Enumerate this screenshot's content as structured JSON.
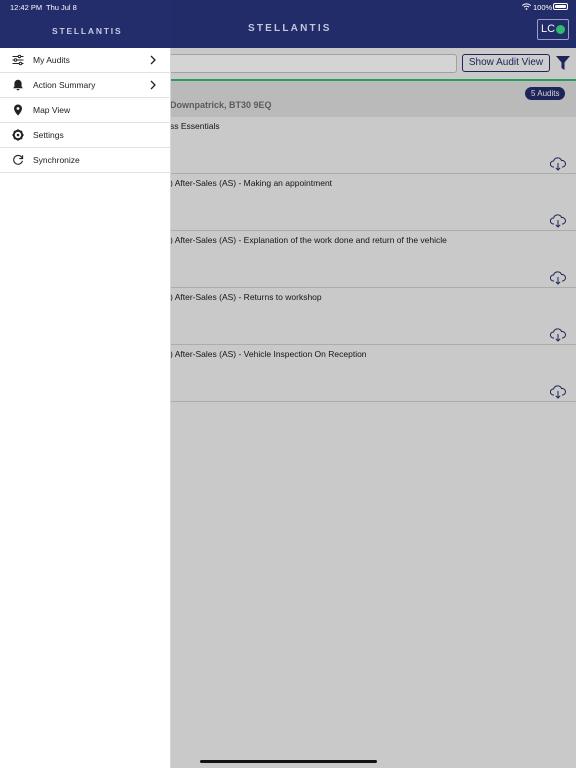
{
  "status_bar": {
    "time": "12:42 PM",
    "date": "Thu Jul 8",
    "battery": "100%"
  },
  "app": {
    "logo": "STELLANTIS",
    "user_initials": "LC",
    "show_audit_view_label": "Show Audit View",
    "site_address": "Downpatrick, BT30 9EQ",
    "audits_count_label": "5 Audits",
    "audits": [
      {
        "title": "ss Essentials"
      },
      {
        "title": ") After-Sales (AS) - Making an appointment"
      },
      {
        "title": ") After-Sales (AS) - Explanation of the work done and return of the vehicle"
      },
      {
        "title": ") After-Sales (AS) - Returns to workshop"
      },
      {
        "title": ") After-Sales (AS) - Vehicle Inspection On Reception"
      }
    ]
  },
  "drawer": {
    "logo": "STELLANTIS",
    "items": [
      {
        "label": "My Audits",
        "icon": "sliders-icon",
        "has_chevron": true
      },
      {
        "label": "Action Summary",
        "icon": "bell-icon",
        "has_chevron": true
      },
      {
        "label": "Map View",
        "icon": "map-pin-icon",
        "has_chevron": false
      },
      {
        "label": "Settings",
        "icon": "gear-icon",
        "has_chevron": false
      },
      {
        "label": "Synchronize",
        "icon": "sync-icon",
        "has_chevron": false
      }
    ]
  },
  "colors": {
    "brand": "#232d6b",
    "status_green": "#2fbf71"
  }
}
